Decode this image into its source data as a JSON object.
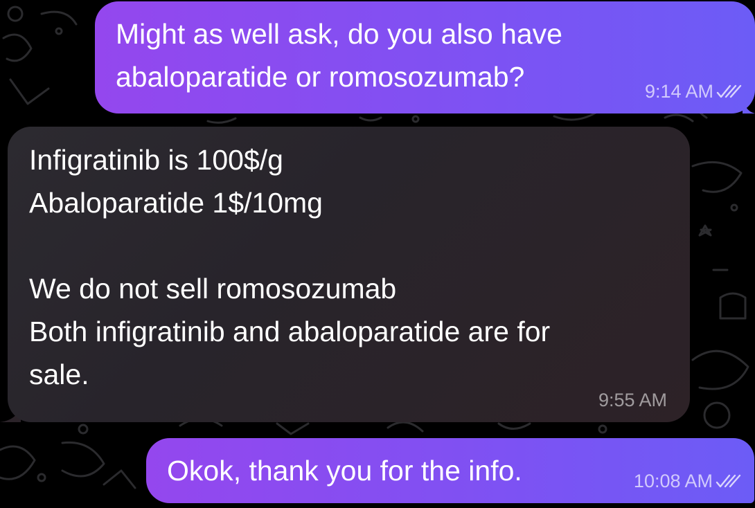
{
  "chat": {
    "messages": [
      {
        "direction": "outgoing",
        "lines": [
          "Might as well ask, do you also have",
          "abaloparatide or romosozumab?"
        ],
        "time": "9:14 AM",
        "status": "read-double-check-icon"
      },
      {
        "direction": "incoming",
        "lines": [
          "Infigratinib is 100$/g",
          "Abaloparatide 1$/10mg",
          "",
          "We do not sell romosozumab",
          "Both infigratinib and abaloparatide are for",
          "sale."
        ],
        "time": "9:55 AM"
      },
      {
        "direction": "outgoing",
        "lines": [
          "Okok, thank you for the info."
        ],
        "time": "10:08 AM",
        "status": "read-double-check-icon"
      }
    ]
  },
  "colors": {
    "background": "#000000",
    "outgoing_bubble_start": "#9447ee",
    "outgoing_bubble_end": "#6c5cf6",
    "incoming_bubble": "#2a272d",
    "wallpaper_doodles": "#2b2b2e",
    "text": "#ffffff"
  }
}
